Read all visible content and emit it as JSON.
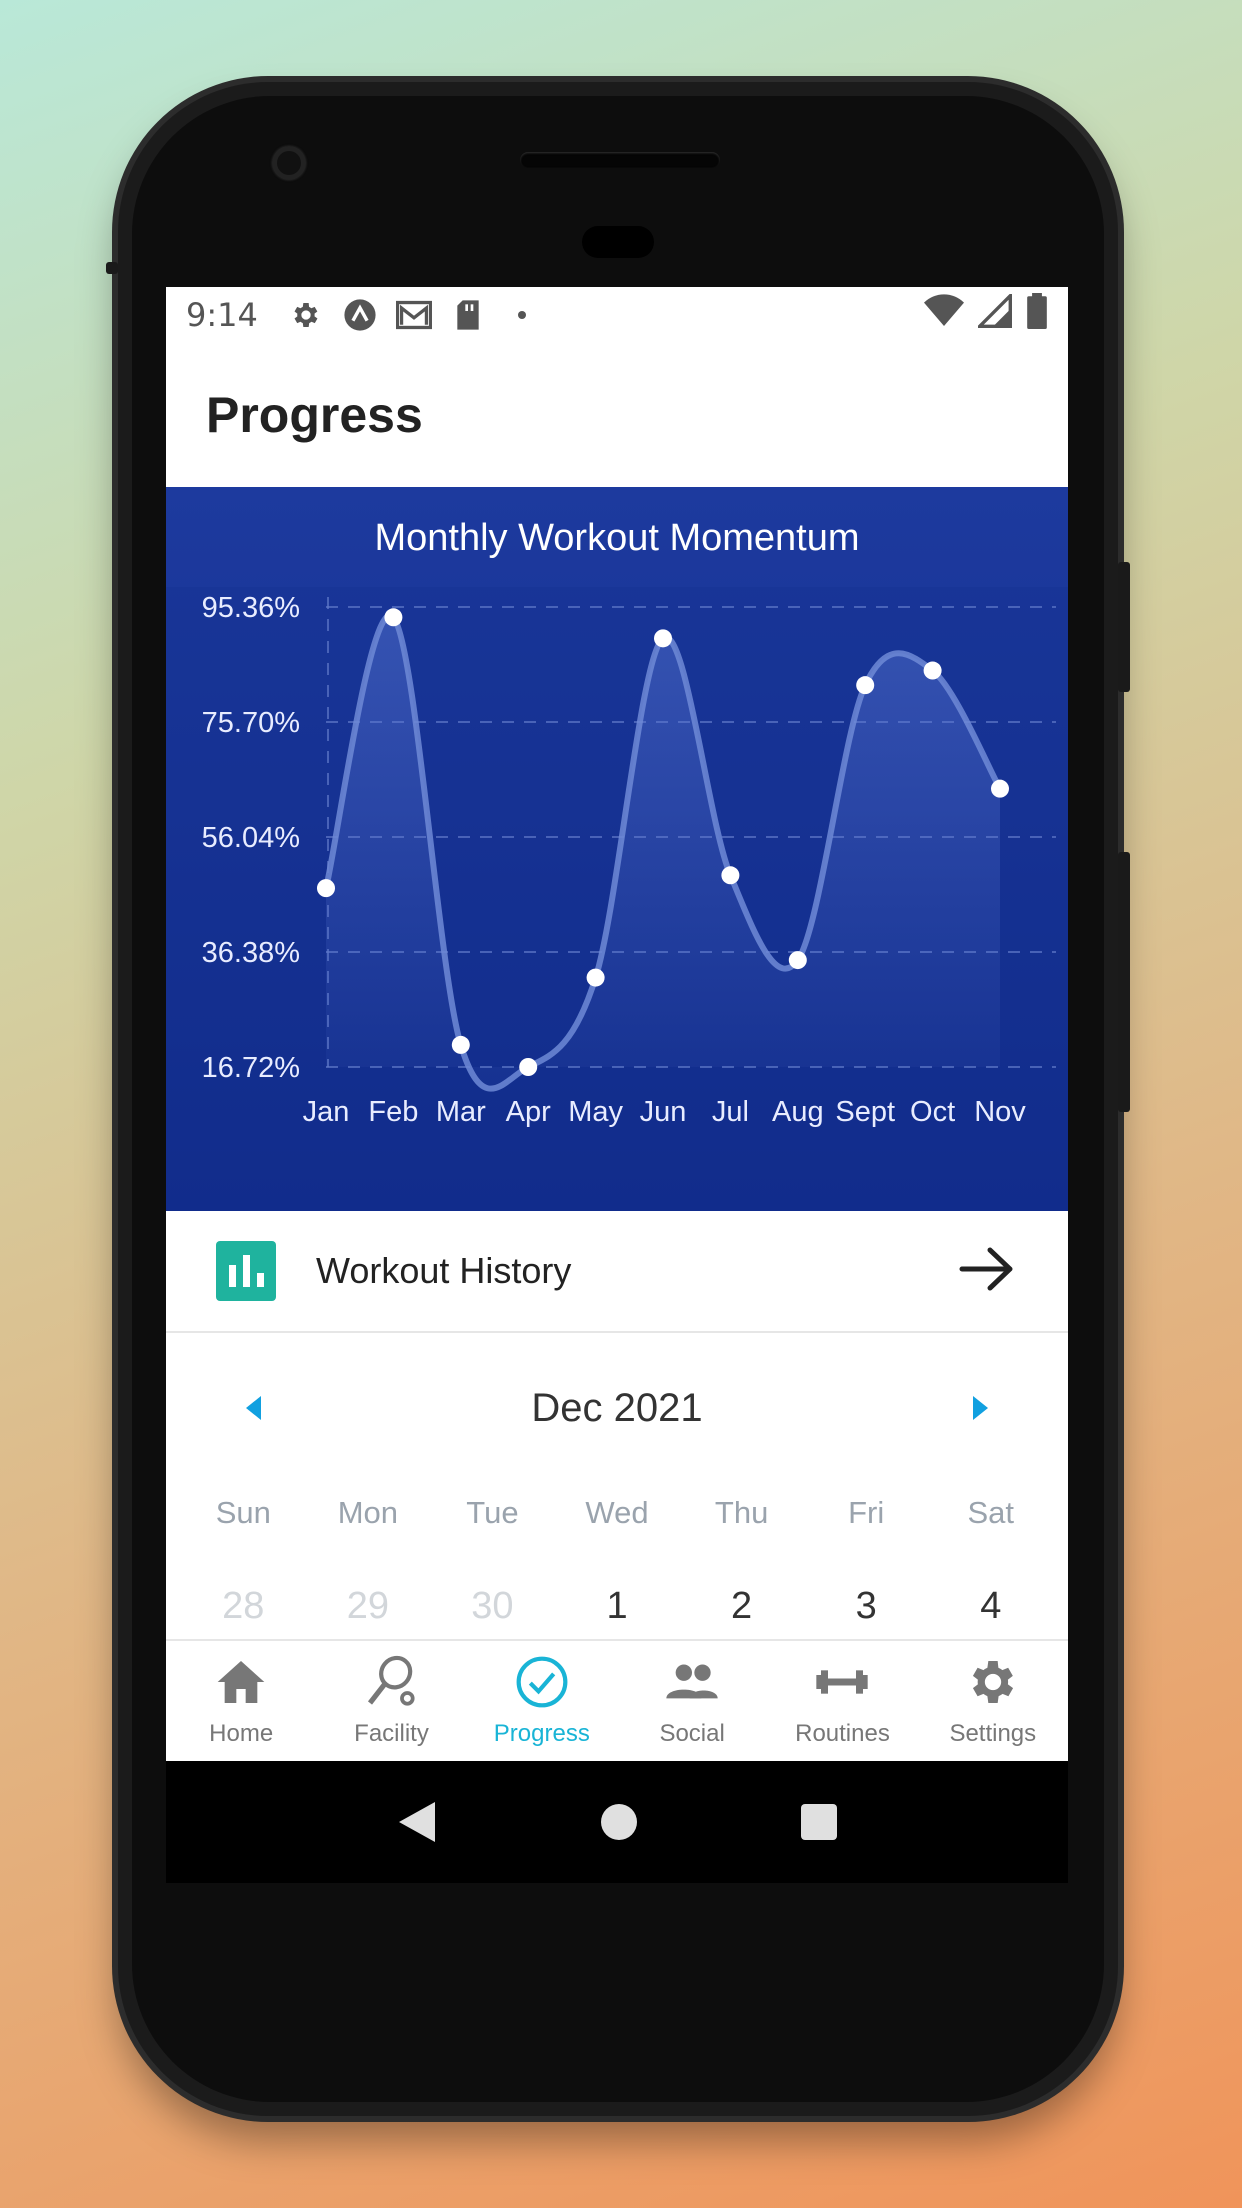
{
  "status_bar": {
    "time": "9:14",
    "left_icons": [
      "gear-icon",
      "upload-icon",
      "mail-icon",
      "sd-card-icon",
      "dot-icon"
    ],
    "right_icons": [
      "wifi-icon",
      "signal-icon",
      "battery-icon"
    ]
  },
  "app_bar": {
    "title": "Progress"
  },
  "chart_card": {
    "background_color": "#1d3a9e",
    "line_color": "#6f8ad6",
    "point_color": "#ffffff"
  },
  "chart_data": {
    "type": "line",
    "title": "Monthly Workout Momentum",
    "categories": [
      "Jan",
      "Feb",
      "Mar",
      "Apr",
      "May",
      "Jun",
      "Jul",
      "Aug",
      "Sept",
      "Oct",
      "Nov"
    ],
    "series": [
      {
        "values": [
          47.3,
          93.6,
          20.5,
          16.72,
          32.0,
          90.0,
          49.5,
          35.0,
          82.0,
          84.5,
          64.3
        ]
      }
    ],
    "y_ticks": [
      "95.36%",
      "75.70%",
      "56.04%",
      "36.38%",
      "16.72%"
    ],
    "ylim": [
      16.72,
      95.36
    ],
    "grid": true,
    "smooth": true,
    "area_fill": true
  },
  "workout_history": {
    "label": "Workout History",
    "icon": "bar-chart-icon",
    "arrow": "arrow-right-icon",
    "accent": "#1fb39e"
  },
  "calendar": {
    "title": "Dec 2021",
    "weekdays": [
      "Sun",
      "Mon",
      "Tue",
      "Wed",
      "Thu",
      "Fri",
      "Sat"
    ],
    "first_week": [
      {
        "day": "28",
        "muted": true
      },
      {
        "day": "29",
        "muted": true
      },
      {
        "day": "30",
        "muted": true
      },
      {
        "day": "1",
        "muted": false
      },
      {
        "day": "2",
        "muted": false
      },
      {
        "day": "3",
        "muted": false
      },
      {
        "day": "4",
        "muted": false
      }
    ],
    "accent": "#11a0e0"
  },
  "bottom_nav": {
    "active_color": "#19b4d6",
    "items": [
      {
        "label": "Home",
        "icon": "home-icon",
        "active": false
      },
      {
        "label": "Facility",
        "icon": "racket-icon",
        "active": false
      },
      {
        "label": "Progress",
        "icon": "check-circle-icon",
        "active": true
      },
      {
        "label": "Social",
        "icon": "people-icon",
        "active": false
      },
      {
        "label": "Routines",
        "icon": "dumbbell-icon",
        "active": false
      },
      {
        "label": "Settings",
        "icon": "gear-icon",
        "active": false
      }
    ]
  },
  "system_nav": [
    "back-icon",
    "home-circle-icon",
    "recents-icon"
  ]
}
